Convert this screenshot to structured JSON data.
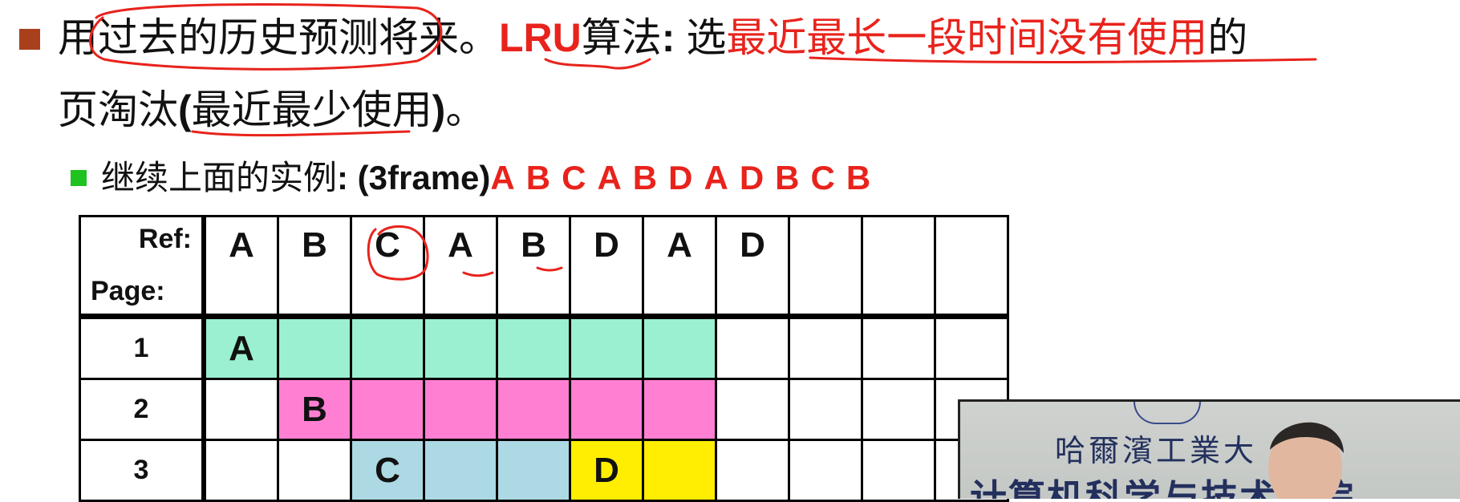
{
  "line1": {
    "text_a": "用过去的历史预测将来。",
    "lru": "LRU",
    "text_b": "算法",
    "colon": ": ",
    "xuan": "选",
    "red_phrase": "最近最长一段时间没有使用",
    "de": "的"
  },
  "line2": {
    "ye": "页淘汰",
    "open": "(",
    "red_inner": "最近最少使用",
    "close": ")",
    "period": "。"
  },
  "sub": {
    "label": "继续上面的实例",
    "colon": ": ",
    "frames": "(3frame)",
    "sequence": [
      "A",
      "B",
      "C",
      "A",
      "B",
      "D",
      "A",
      "D",
      "B",
      "C",
      "B"
    ]
  },
  "table": {
    "ref_label": "Ref:",
    "page_label": "Page:",
    "refs": [
      "A",
      "B",
      "C",
      "A",
      "B",
      "D",
      "A",
      "D",
      "",
      "",
      ""
    ],
    "rows": [
      {
        "label": "1",
        "cells": [
          "A",
          "",
          "",
          "",
          "",
          "",
          "",
          "",
          "",
          "",
          ""
        ]
      },
      {
        "label": "2",
        "cells": [
          "",
          "B",
          "",
          "",
          "",
          "",
          "",
          "",
          "",
          "",
          ""
        ]
      },
      {
        "label": "3",
        "cells": [
          "",
          "",
          "C",
          "",
          "",
          "D",
          "",
          "",
          "",
          "",
          ""
        ]
      }
    ]
  },
  "video": {
    "school": "哈爾濱工業大",
    "dept": "计算机科学与技术学院"
  },
  "colors": {
    "frame1": "#9af0d0",
    "frame2": "#ff7fd3",
    "frame3": "#acd9e4",
    "frame3_new": "#ffee00",
    "accent_red": "#e8231c",
    "bullet": "#a8401c",
    "sub_bullet": "#1fc21f"
  }
}
